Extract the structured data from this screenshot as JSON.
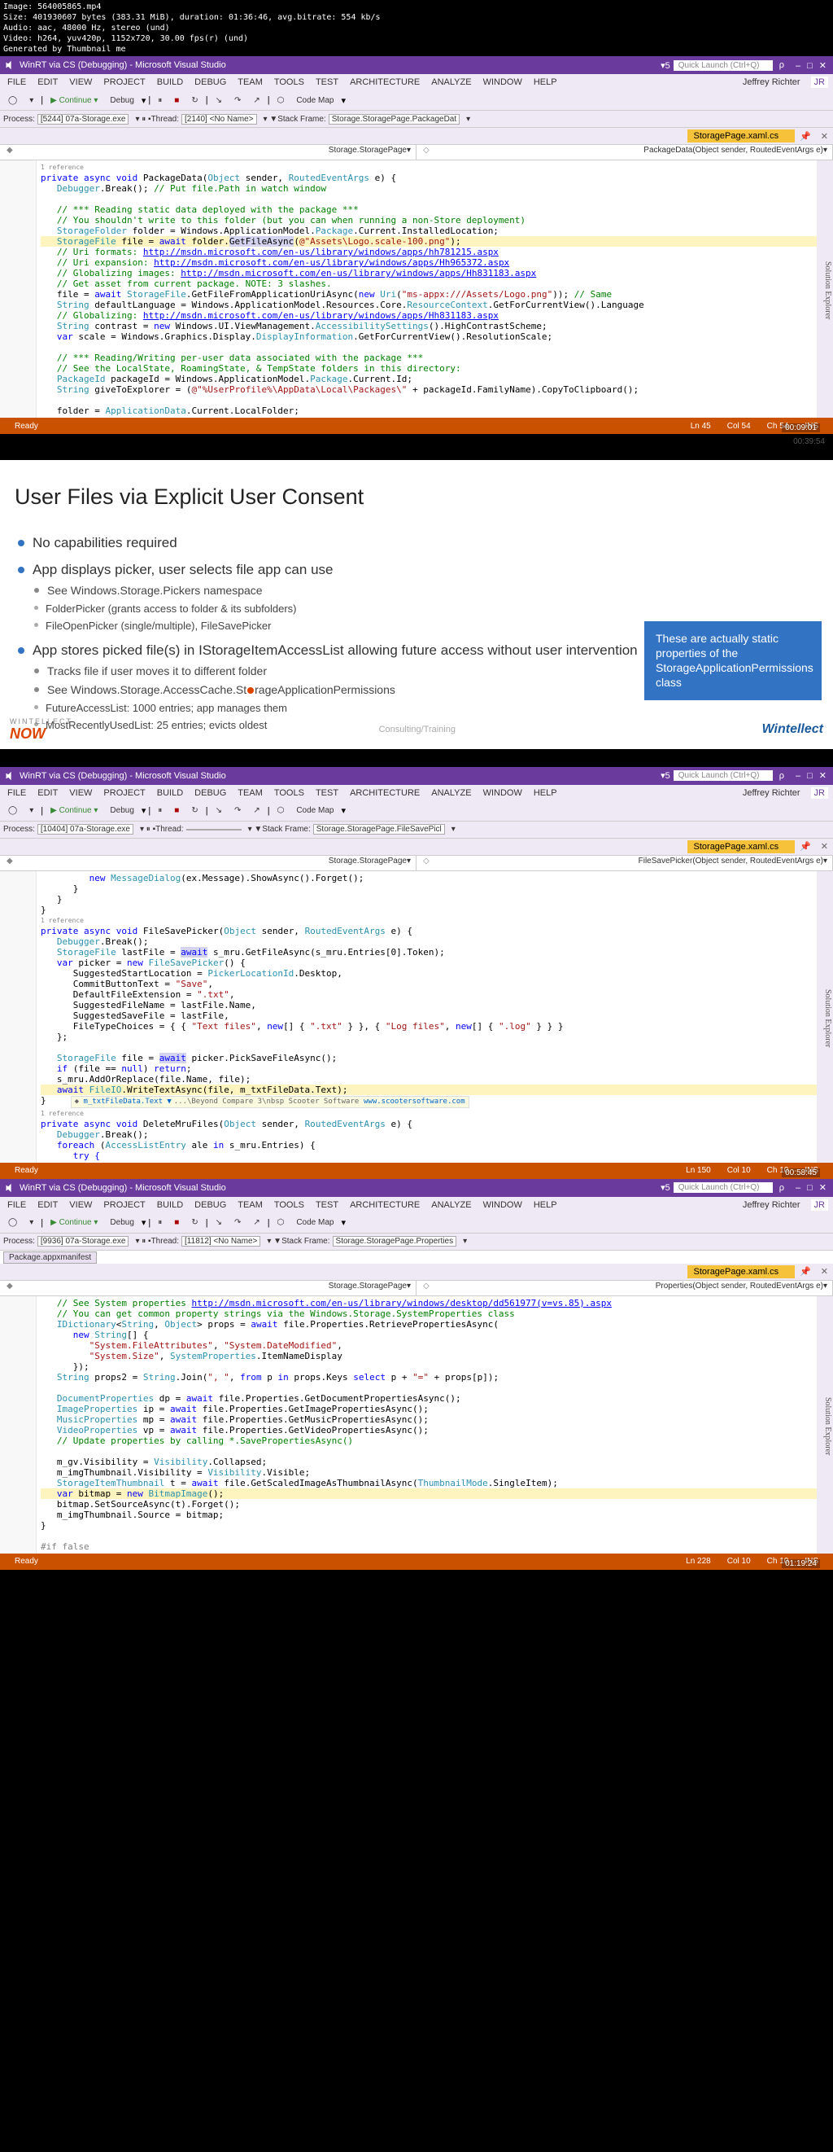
{
  "media_info": {
    "filename": "Image: 564005865.mp4",
    "size": "Size: 401930607 bytes (383.31 MiB), duration: 01:36:46, avg.bitrate: 554 kb/s",
    "audio": "Audio: aac, 48000 Hz, stereo (und)",
    "video": "Video: h264, yuv420p, 1152x720, 30.00 fps(r) (und)",
    "gen": "Generated by Thumbnail me"
  },
  "timestamps": {
    "t1": "00:09:01",
    "t2": "00:39:54",
    "t3": "00:58:45",
    "t4": "01:19:24"
  },
  "vs": {
    "title": "WinRT via CS (Debugging) - Microsoft Visual Studio",
    "search_ph": "Quick Launch (Ctrl+Q)",
    "user": "Jeffrey Richter",
    "menu": [
      "FILE",
      "EDIT",
      "VIEW",
      "PROJECT",
      "BUILD",
      "DEBUG",
      "TEAM",
      "TOOLS",
      "TEST",
      "ARCHITECTURE",
      "ANALYZE",
      "WINDOW",
      "HELP"
    ],
    "continue": "Continue",
    "debug_cfg": "Debug",
    "codemap": "Code Map",
    "tab": "StoragePage.xaml.cs",
    "se": "Solution Explorer"
  },
  "proc1": {
    "label": "Process:",
    "val": "[5244] 07a-Storage.exe",
    "th": "Thread:",
    "thval": "[2140] <No Name>",
    "sf": "Stack Frame:",
    "sfval": "Storage.StoragePage.PackageDat"
  },
  "nav1": {
    "left": "Storage.StoragePage",
    "right": "PackageData(Object sender, RoutedEventArgs e)"
  },
  "status1": {
    "ready": "Ready",
    "ln": "Ln 45",
    "col": "Col 54",
    "ch": "Ch 54",
    "ins": "INS"
  },
  "code1": {
    "l1a": "private",
    "l1b": "async",
    "l1c": "void",
    "l1d": " PackageData(",
    "l1e": "Object",
    "l1f": " sender, ",
    "l1g": "RoutedEventArgs",
    "l1h": " e) {",
    "l2a": "Debugger",
    "l2b": ".Break(); ",
    "l2c": "// Put file.Path in watch window",
    "l4": "// *** Reading static data deployed with the package ***",
    "l5": "// You shouldn't write to this folder (but you can when running a non-Store deployment)",
    "l6a": "StorageFolder",
    "l6b": " folder = Windows.ApplicationModel.",
    "l6c": "Package",
    "l6d": ".Current.InstalledLocation;",
    "l7a": "StorageFile",
    "l7b": " file = ",
    "l7c": "await",
    "l7d": " folder.",
    "l7e": "GetFileAsync",
    "l7f": "(",
    "l7g": "@\"Assets\\Logo.scale-100.png\"",
    "l7h": ");",
    "l8a": "// Uri formats: ",
    "l8b": "http://msdn.microsoft.com/en-us/library/windows/apps/hh781215.aspx",
    "l9a": "// Uri expansion: ",
    "l9b": "http://msdn.microsoft.com/en-us/library/windows/apps/Hh965372.aspx",
    "l10a": "// Globalizing images: ",
    "l10b": "http://msdn.microsoft.com/en-us/library/windows/apps/Hh831183.aspx",
    "l11": "// Get asset from current package. NOTE: 3 slashes.",
    "l12a": "file = ",
    "l12b": "await",
    "l12c": " StorageFile",
    "l12d": ".GetFileFromApplicationUriAsync(",
    "l12e": "new",
    "l12f": " Uri",
    "l12g": "(",
    "l12h": "\"ms-appx:///Assets/Logo.png\"",
    "l12i": "));   ",
    "l12j": "// Same",
    "l13a": "String",
    "l13b": " defaultLanguage = Windows.ApplicationModel.Resources.Core.",
    "l13c": "ResourceContext",
    "l13d": ".GetForCurrentView().Language",
    "l14a": "// Globalizing: ",
    "l14b": "http://msdn.microsoft.com/en-us/library/windows/apps/Hh831183.aspx",
    "l15a": "String",
    "l15b": " contrast = ",
    "l15c": "new",
    "l15d": " Windows.UI.ViewManagement.",
    "l15e": "AccessibilitySettings",
    "l15f": "().HighContrastScheme;",
    "l16a": "var",
    "l16b": " scale = Windows.Graphics.Display.",
    "l16c": "DisplayInformation",
    "l16d": ".GetForCurrentView().ResolutionScale;",
    "l18": "// *** Reading/Writing per-user data associated with the package ***",
    "l19": "// See the LocalState, RoamingState, & TempState folders in this directory:",
    "l20a": "PackageId",
    "l20b": " packageId = Windows.ApplicationModel.",
    "l20c": "Package",
    "l20d": ".Current.Id;",
    "l21a": "String",
    "l21b": " giveToExplorer = (",
    "l21c": "@\"%UserProfile%\\AppData\\Local\\Packages\\\"",
    "l21d": " + packageId.FamilyName).CopyToClipboard();",
    "l23a": "folder = ",
    "l23b": "ApplicationData",
    "l23c": ".Current.LocalFolder;"
  },
  "slide": {
    "title": "User Files via Explicit User Consent",
    "b1": "No capabilities required",
    "b2": "App displays picker, user selects file app can use",
    "b2a": "See Windows.Storage.Pickers namespace",
    "b2a1": "FolderPicker (grants access to folder & its subfolders)",
    "b2a2": "FileOpenPicker (single/multiple), FileSavePicker",
    "b3": "App stores picked file(s) in IStorageItemAccessList allowing future access without user intervention",
    "b3a": "Tracks file if user moves it to different folder",
    "b3b_pre": "See Windows.Storage.AccessCache.St",
    "b3b_post": "rageApplicationPermissions",
    "b3b1": "FutureAccessList:        1000 entries; app manages them",
    "b3b2": "MostRecentlyUsedList:    25 entries; evicts oldest",
    "callout": "These are actually static properties of the StorageApplicationPermissions class",
    "footer_mid": "Consulting/Training",
    "logo_l1": "WINTELLECT",
    "logo_l2": "NOW",
    "logo_r": "Wintellect"
  },
  "proc2": {
    "label": "Process:",
    "val": "[10404] 07a-Storage.exe",
    "th": "Thread:",
    "thval": "",
    "sf": "Stack Frame:",
    "sfval": "Storage.StoragePage.FileSavePicl"
  },
  "nav2": {
    "left": "Storage.StoragePage",
    "right": "FileSavePicker(Object sender, RoutedEventArgs e)"
  },
  "status2": {
    "ready": "Ready",
    "ln": "Ln 150",
    "col": "Col 10",
    "ch": "Ch 10",
    "ins": "INS"
  },
  "code2": {
    "l1a": "new",
    "l1b": " MessageDialog",
    "l1c": "(ex.Message).ShowAsync().Forget();",
    "l5a": "private",
    "l5b": "async",
    "l5c": "void",
    "l5d": " FileSavePicker(",
    "l5e": "Object",
    "l5f": " sender, ",
    "l5g": "RoutedEventArgs",
    "l5h": " e) {",
    "l6a": "Debugger",
    "l6b": ".Break();",
    "l7a": "StorageFile",
    "l7b": " lastFile = ",
    "l7c": "await",
    "l7d": " s_mru.GetFileAsync(s_mru.Entries[0].Token);",
    "l8a": "var",
    "l8b": " picker = ",
    "l8c": "new",
    "l8d": " FileSavePicker",
    "l8e": "() {",
    "l9a": "SuggestedStartLocation = ",
    "l9b": "PickerLocationId",
    "l9c": ".Desktop,",
    "l10a": "CommitButtonText = ",
    "l10b": "\"Save\"",
    "l10c": ",",
    "l11a": "DefaultFileExtension = ",
    "l11b": "\".txt\"",
    "l11c": ",",
    "l12": "SuggestedFileName = lastFile.Name,",
    "l13": "SuggestedSaveFile = lastFile,",
    "l14a": "FileTypeChoices = { { ",
    "l14b": "\"Text files\"",
    "l14c": ", ",
    "l14d": "new",
    "l14e": "[] { ",
    "l14f": "\".txt\"",
    "l14g": " } }, { ",
    "l14h": "\"Log files\"",
    "l14i": ", ",
    "l14j": "new",
    "l14k": "[] { ",
    "l14l": "\".log\"",
    "l14m": " } } }",
    "l15": "};",
    "l17a": "StorageFile",
    "l17b": " file = ",
    "l17c": "await",
    "l17d": " picker.PickSaveFileAsync();",
    "l18a": "if",
    "l18b": " (file == ",
    "l18c": "null",
    "l18d": ") ",
    "l18e": "return",
    "l18f": ";",
    "l19": "s_mru.AddOrReplace(file.Name, file);",
    "l20a": "await",
    "l20b": " FileIO",
    "l20c": ".WriteTextAsync(file, m_txtFileData.Text);",
    "scootL": "m_txtFileData.Text ▼",
    "scootM": "...\\Beyond Compare 3\\nbsp Scooter Software",
    "scootR": "www.scootersoftware.com",
    "l22a": "private",
    "l22b": "async",
    "l22c": "void",
    "l22d": " DeleteMruFiles(",
    "l22e": "Object",
    "l22f": " sender, ",
    "l22g": "RoutedEventArgs",
    "l22h": " e) {",
    "l23a": "Debugger",
    "l23b": ".Break();",
    "l24a": "foreach",
    "l24b": " (",
    "l24c": "AccessListEntry",
    "l24d": " ale ",
    "l24e": "in",
    "l24f": " s_mru.Entries) {",
    "l25": "try {"
  },
  "proc3": {
    "label": "Process:",
    "val": "[9936] 07a-Storage.exe",
    "th": "Thread:",
    "thval": "[11812] <No Name>",
    "sf": "Stack Frame:",
    "sfval": "Storage.StoragePage.Properties"
  },
  "nav3": {
    "left": "Storage.StoragePage",
    "right": "Properties(Object sender, RoutedEventArgs e)"
  },
  "appman": "Package.appxmanifest",
  "status3": {
    "ready": "Ready",
    "ln": "Ln 228",
    "col": "Col 10",
    "ch": "Ch 10",
    "ins": "INS"
  },
  "code3": {
    "l1a": "// See System properties ",
    "l1b": "http://msdn.microsoft.com/en-us/library/windows/desktop/dd561977(v=vs.85).aspx",
    "l2": "// You can get common property strings via the Windows.Storage.SystemProperties class",
    "l3a": "IDictionary",
    "l3b": "<",
    "l3c": "String",
    "l3d": ", ",
    "l3e": "Object",
    "l3f": "> props = ",
    "l3g": "await",
    "l3h": " file.Properties.RetrievePropertiesAsync(",
    "l4a": "new",
    "l4b": " String",
    "l4c": "[] {",
    "l5a": "\"System.FileAttributes\"",
    "l5b": ", ",
    "l5c": "\"System.DateModified\"",
    "l5d": ",",
    "l6a": "\"System.Size\"",
    "l6b": ", ",
    "l6c": "SystemProperties",
    "l6d": ".ItemNameDisplay",
    "l7": "});",
    "l8a": "String",
    "l8b": " props2 = ",
    "l8c": "String",
    "l8d": ".Join(",
    "l8e": "\", \"",
    "l8f": ", ",
    "l8g": "from",
    "l8h": " p ",
    "l8i": "in",
    "l8j": " props.Keys ",
    "l8k": "select",
    "l8l": " p + ",
    "l8m": "\"=\"",
    "l8n": " + props[p]);",
    "l10a": "DocumentProperties",
    "l10b": " dp = ",
    "l10c": "await",
    "l10d": " file.Properties.GetDocumentPropertiesAsync();",
    "l11a": "ImageProperties",
    "l11b": "    ip = ",
    "l11c": "await",
    "l11d": " file.Properties.GetImagePropertiesAsync();",
    "l12a": "MusicProperties",
    "l12b": "    mp = ",
    "l12c": "await",
    "l12d": " file.Properties.GetMusicPropertiesAsync();",
    "l13a": "VideoProperties",
    "l13b": "    vp = ",
    "l13c": "await",
    "l13d": " file.Properties.GetVideoPropertiesAsync();",
    "l14": "// Update properties by calling *.SavePropertiesAsync()",
    "l16a": "m_gv.Visibility = ",
    "l16b": "Visibility",
    "l16c": ".Collapsed;",
    "l17a": "m_imgThumbnail.Visibility = ",
    "l17b": "Visibility",
    "l17c": ".Visible;",
    "l18a": "StorageItemThumbnail",
    "l18b": " t = ",
    "l18c": "await",
    "l18d": " file.GetScaledImageAsThumbnailAsync(",
    "l18e": "ThumbnailMode",
    "l18f": ".SingleItem);",
    "l19a": "var",
    "l19b": " bitmap = ",
    "l19c": "new",
    "l19d": " BitmapImage",
    "l19e": "();",
    "l20": "bitmap.SetSourceAsync(t).Forget();",
    "l21": "m_imgThumbnail.Source = bitmap;",
    "l24a": "#if",
    "l24b": " false"
  }
}
